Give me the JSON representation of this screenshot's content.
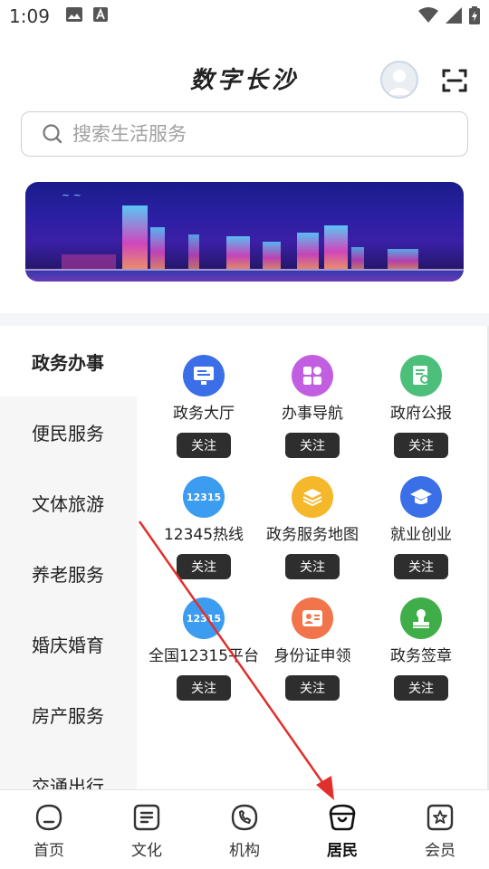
{
  "status_bar": {
    "time": "1:09"
  },
  "header": {
    "title": "数字长沙"
  },
  "search": {
    "placeholder": "搜索生活服务"
  },
  "sidebar": {
    "items": [
      {
        "label": "政务办事",
        "active": true
      },
      {
        "label": "便民服务"
      },
      {
        "label": "文体旅游"
      },
      {
        "label": "养老服务"
      },
      {
        "label": "婚庆婚育"
      },
      {
        "label": "房产服务"
      },
      {
        "label": "交通出行"
      }
    ]
  },
  "services": [
    {
      "name": "政务大厅",
      "icon": "monitor-icon",
      "color": "#3a6fe8",
      "follow": "关注"
    },
    {
      "name": "办事导航",
      "icon": "grid-icon",
      "color": "#c25fe0",
      "follow": "关注"
    },
    {
      "name": "政府公报",
      "icon": "document-search-icon",
      "color": "#4cbf7a",
      "follow": "关注"
    },
    {
      "name": "12345热线",
      "icon": "hotline-12315-icon",
      "icon_text": "12315",
      "color": "#3c9cf0",
      "follow": "关注"
    },
    {
      "name": "政务服务地图",
      "icon": "layers-icon",
      "color": "#f5b82a",
      "follow": "关注"
    },
    {
      "name": "就业创业",
      "icon": "graduation-cap-icon",
      "color": "#3a6fe8",
      "follow": "关注"
    },
    {
      "name": "全国12315平台",
      "icon": "platform-12315-icon",
      "icon_text": "12315",
      "color": "#3c9cf0",
      "follow": "关注"
    },
    {
      "name": "身份证申领",
      "icon": "id-card-icon",
      "color": "#f2744a",
      "follow": "关注"
    },
    {
      "name": "政务签章",
      "icon": "stamp-icon",
      "color": "#3fae49",
      "follow": "关注"
    }
  ],
  "bottom_nav": [
    {
      "label": "首页",
      "icon": "home-icon"
    },
    {
      "label": "文化",
      "icon": "culture-icon"
    },
    {
      "label": "机构",
      "icon": "phone-icon"
    },
    {
      "label": "居民",
      "icon": "resident-icon",
      "active": true
    },
    {
      "label": "会员",
      "icon": "member-icon"
    }
  ]
}
